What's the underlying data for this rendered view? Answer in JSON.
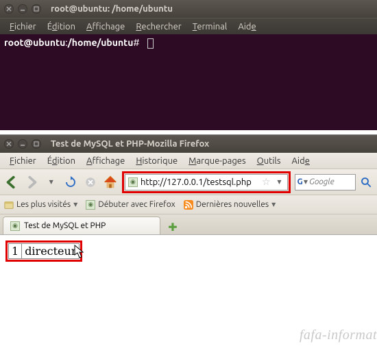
{
  "terminal": {
    "title": "root@ubuntu: /home/ubuntu",
    "menu": [
      "Fichier",
      "Édition",
      "Affichage",
      "Rechercher",
      "Terminal",
      "Aide"
    ],
    "prompt_user": "root@ubuntu",
    "prompt_sep": ":",
    "prompt_path": "/home/ubuntu",
    "prompt_symbol": "#"
  },
  "firefox": {
    "title": "Test de MySQL et PHP-Mozilla Firefox",
    "menu": [
      "Fichier",
      "Édition",
      "Affichage",
      "Historique",
      "Marque-pages",
      "Outils",
      "Aide"
    ],
    "url": "http://127.0.0.1/testsql.php",
    "search_placeholder": "Google",
    "bookmarks": {
      "most_visited": "Les plus visités",
      "getting_started": "Débuter avec Firefox",
      "latest_news": "Dernières nouvelles"
    },
    "tab_label": "Test de MySQL et PHP",
    "result": {
      "col1": "1",
      "col2": "directeur"
    }
  },
  "watermark": "fafa-informat"
}
